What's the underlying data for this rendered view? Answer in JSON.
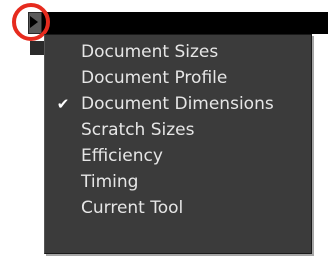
{
  "status_bar": {
    "menu_button_icon": "triangle-right-icon"
  },
  "menu": {
    "items": [
      {
        "label": "Document Sizes",
        "checked": false
      },
      {
        "label": "Document Profile",
        "checked": false
      },
      {
        "label": "Document Dimensions",
        "checked": true
      },
      {
        "label": "Scratch Sizes",
        "checked": false
      },
      {
        "label": "Efficiency",
        "checked": false
      },
      {
        "label": "Timing",
        "checked": false
      },
      {
        "label": "Current Tool",
        "checked": false
      }
    ],
    "check_glyph": "✔"
  },
  "colors": {
    "menu_background": "#3b3b3b",
    "menu_text": "#e6e6e6",
    "status_bar": "#000000",
    "highlight_ring": "#e62b1e"
  }
}
